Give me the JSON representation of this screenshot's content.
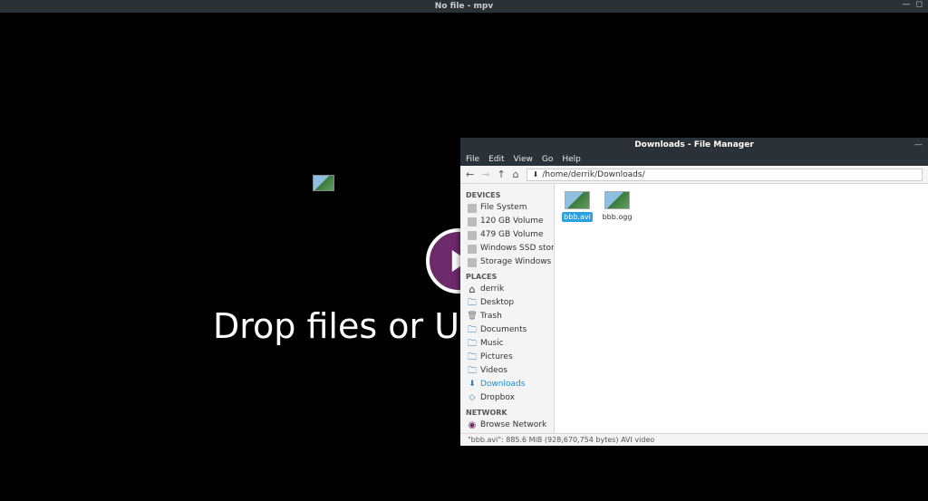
{
  "mpv": {
    "title": "No file - mpv",
    "drop_text": "Drop files or URLs to play here."
  },
  "fm": {
    "title": "Downloads - File Manager",
    "menu": {
      "file": "File",
      "edit": "Edit",
      "view": "View",
      "go": "Go",
      "help": "Help"
    },
    "path": "/home/derrik/Downloads/",
    "sections": {
      "devices": "DEVICES",
      "places": "PLACES",
      "network": "NETWORK"
    },
    "devices": [
      {
        "label": "File System"
      },
      {
        "label": "120 GB Volume"
      },
      {
        "label": "479 GB Volume"
      },
      {
        "label": "Windows SSD storage"
      },
      {
        "label": "Storage Windows"
      }
    ],
    "places": [
      {
        "label": "derrik"
      },
      {
        "label": "Desktop"
      },
      {
        "label": "Trash"
      },
      {
        "label": "Documents"
      },
      {
        "label": "Music"
      },
      {
        "label": "Pictures"
      },
      {
        "label": "Videos"
      },
      {
        "label": "Downloads"
      },
      {
        "label": "Dropbox"
      }
    ],
    "network": [
      {
        "label": "Browse Network"
      }
    ],
    "files": [
      {
        "name": "bbb.avi",
        "selected": true
      },
      {
        "name": "bbb.ogg",
        "selected": false
      }
    ],
    "status": "\"bbb.avi\": 885.6 MiB (928,670,754 bytes) AVI video"
  }
}
